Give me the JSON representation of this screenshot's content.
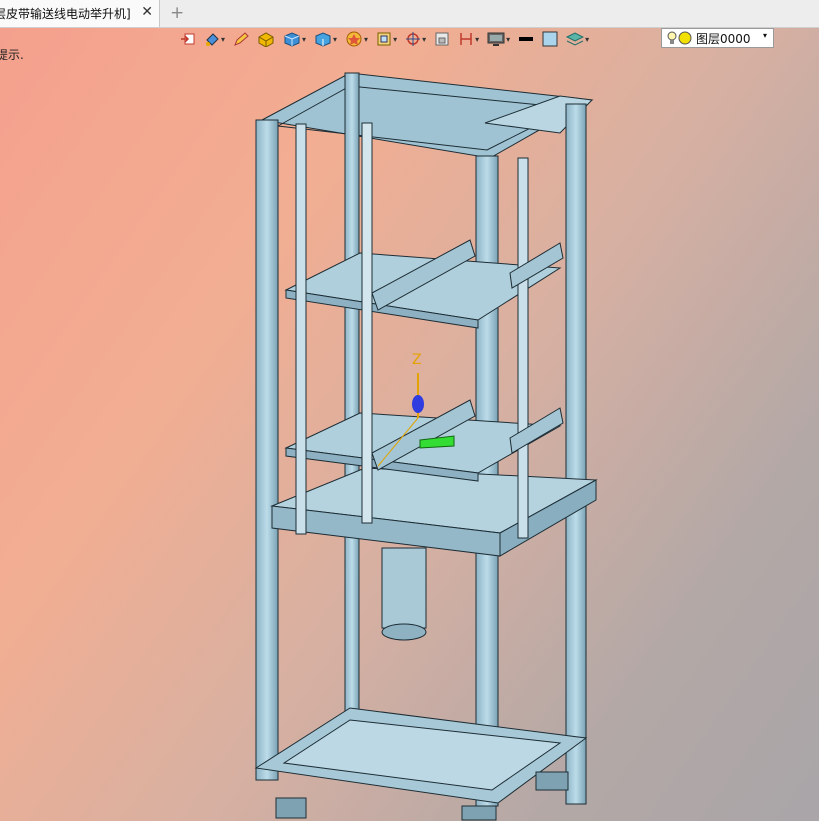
{
  "tab": {
    "title": "层皮带输送线电动举升机]",
    "close_glyph": "✕",
    "add_glyph": "+"
  },
  "hint": {
    "text": "提示."
  },
  "toolbar": {
    "tools": [
      "import-icon",
      "paint-bucket-icon",
      "pencil-icon",
      "shaded-box-icon",
      "wireframe-cube-icon",
      "section-cube-icon",
      "star-shape-icon",
      "render-mode-icon",
      "crosshair-icon",
      "view-box-icon",
      "dimension-icon",
      "monitor-icon",
      "line-color-icon",
      "fill-color-icon",
      "layers-icon"
    ],
    "colors": {
      "line": "#000000",
      "fill": "#aad4ec"
    }
  },
  "layer": {
    "label": "图层0000",
    "dropdown_glyph": "▾"
  },
  "axis": {
    "z_label": "Z"
  }
}
